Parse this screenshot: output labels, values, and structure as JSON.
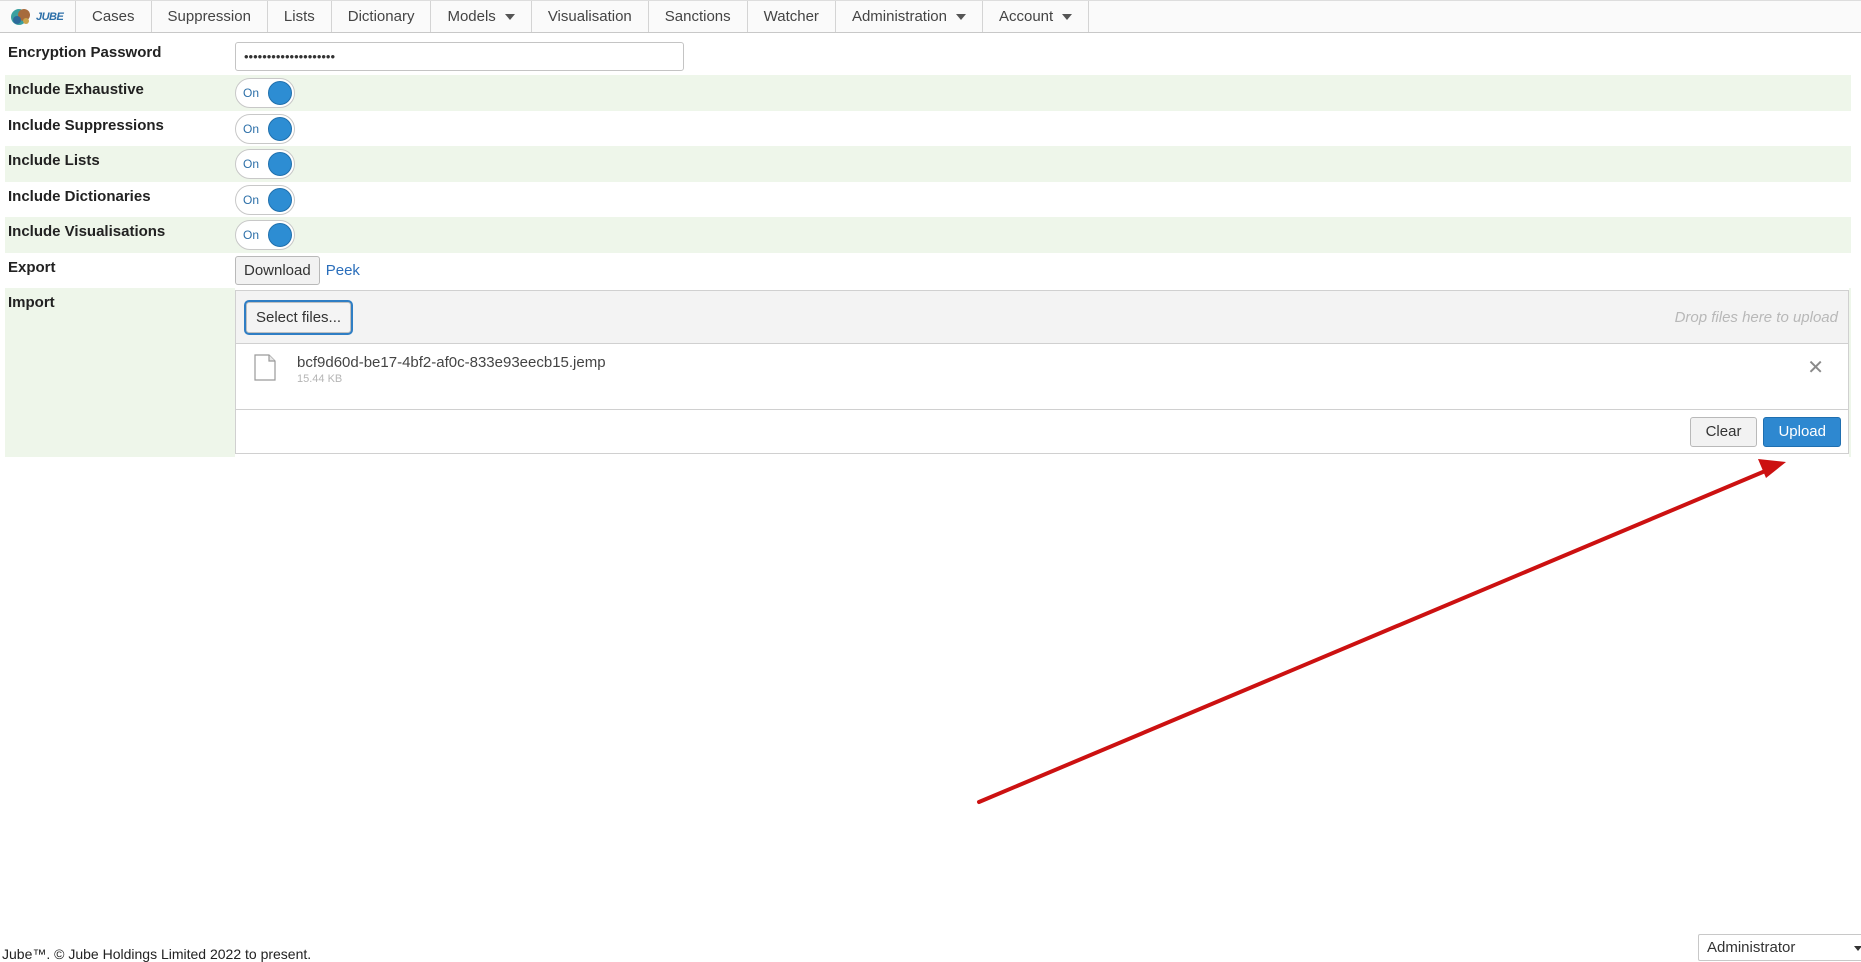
{
  "nav": {
    "logo_text": "JUBE",
    "items": [
      {
        "label": "Cases",
        "has_caret": false
      },
      {
        "label": "Suppression",
        "has_caret": false
      },
      {
        "label": "Lists",
        "has_caret": false
      },
      {
        "label": "Dictionary",
        "has_caret": false
      },
      {
        "label": "Models",
        "has_caret": true
      },
      {
        "label": "Visualisation",
        "has_caret": false
      },
      {
        "label": "Sanctions",
        "has_caret": false
      },
      {
        "label": "Watcher",
        "has_caret": false
      },
      {
        "label": "Administration",
        "has_caret": true
      },
      {
        "label": "Account",
        "has_caret": true
      }
    ]
  },
  "form": {
    "encryption_password": {
      "label": "Encryption Password",
      "value": "••••••••••••••••••••"
    },
    "toggles": [
      {
        "label": "Include Exhaustive",
        "state": "On"
      },
      {
        "label": "Include Suppressions",
        "state": "On"
      },
      {
        "label": "Include Lists",
        "state": "On"
      },
      {
        "label": "Include Dictionaries",
        "state": "On"
      },
      {
        "label": "Include Visualisations",
        "state": "On"
      }
    ],
    "export": {
      "label": "Export",
      "download_label": "Download",
      "peek_label": "Peek"
    },
    "import": {
      "label": "Import",
      "select_files_label": "Select files...",
      "drop_hint": "Drop files here to upload",
      "file": {
        "name": "bcf9d60d-be17-4bf2-af0c-833e93eecb15.jemp",
        "size": "15.44 KB"
      },
      "clear_label": "Clear",
      "upload_label": "Upload"
    }
  },
  "footer": {
    "copyright": "Jube™. © Jube Holdings Limited 2022 to present.",
    "user_menu_selected": "Administrator"
  },
  "colors": {
    "accent": "#2e88d0",
    "row_alt": "#eef6ea",
    "annotation_arrow": "#cc1111"
  }
}
